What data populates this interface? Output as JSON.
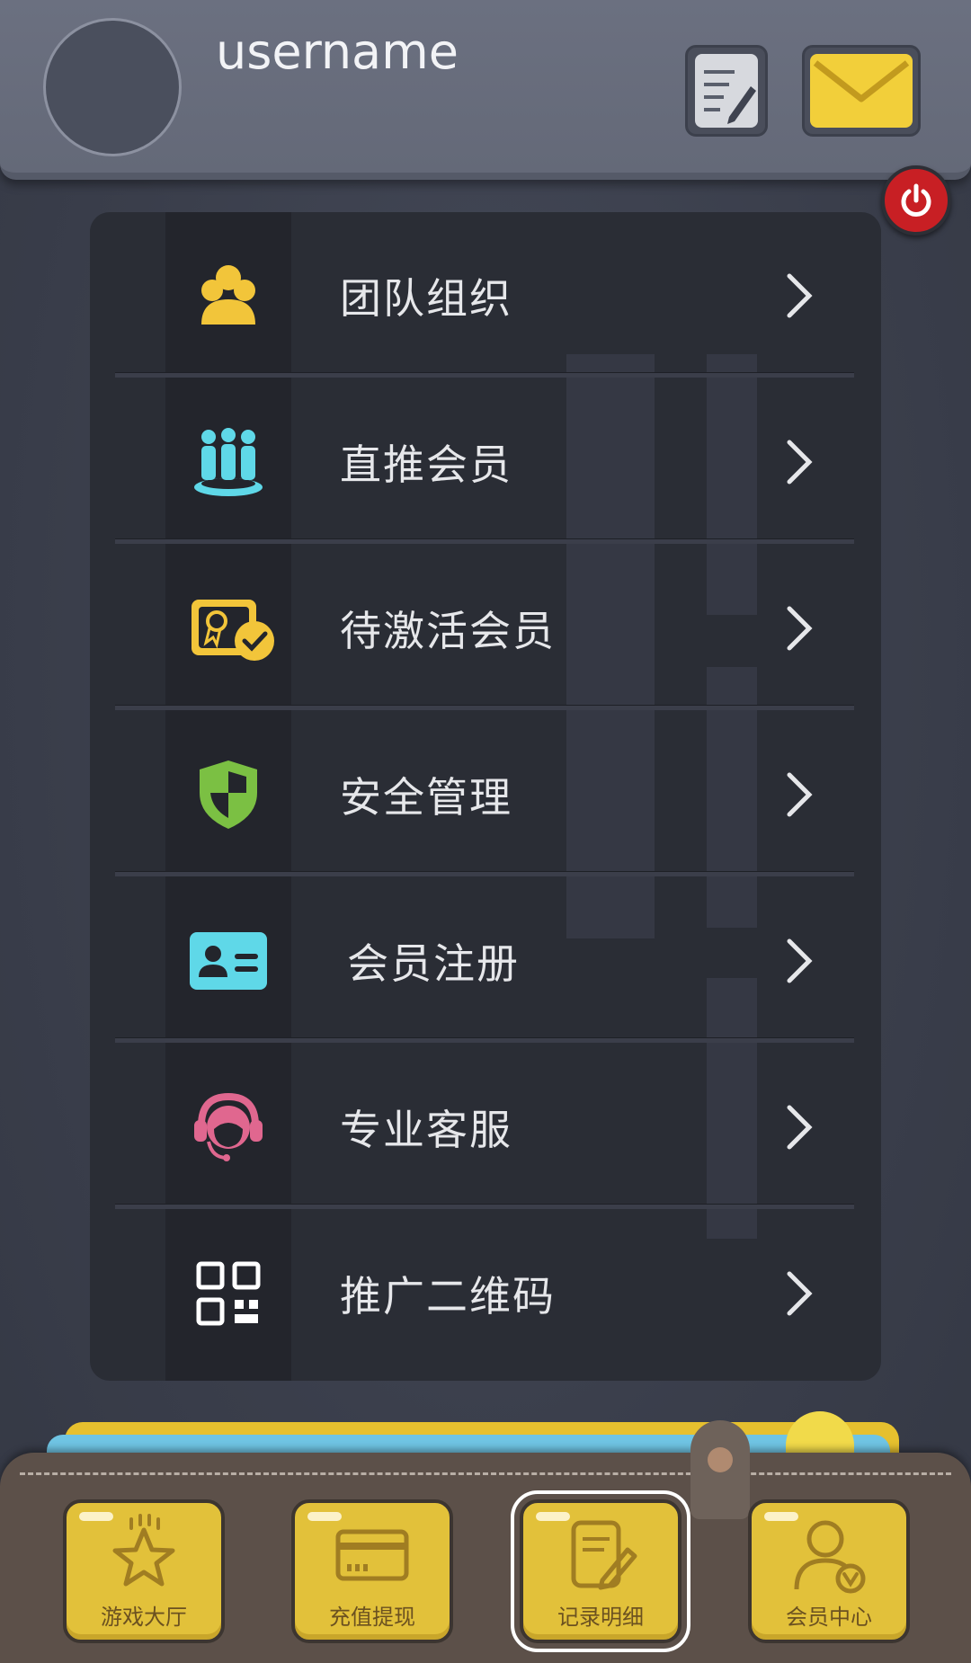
{
  "header": {
    "username": "username"
  },
  "menu": {
    "items": [
      {
        "label": "团队组织",
        "icon": "team-org-icon"
      },
      {
        "label": "直推会员",
        "icon": "direct-members-icon"
      },
      {
        "label": "待激活会员",
        "icon": "pending-activation-icon"
      },
      {
        "label": "安全管理",
        "icon": "security-shield-icon"
      },
      {
        "label": "会员注册",
        "icon": "member-card-icon"
      },
      {
        "label": "专业客服",
        "icon": "customer-service-icon"
      },
      {
        "label": "推广二维码",
        "icon": "qr-code-icon"
      }
    ]
  },
  "bottom_nav": {
    "tabs": [
      {
        "label": "游戏大厅",
        "icon": "star-icon"
      },
      {
        "label": "充值提现",
        "icon": "card-icon"
      },
      {
        "label": "记录明细",
        "icon": "record-edit-icon",
        "active": true
      },
      {
        "label": "会员中心",
        "icon": "member-user-icon"
      }
    ]
  },
  "colors": {
    "accent_yellow": "#e2c13a",
    "power_red": "#c81f24",
    "panel_bg": "#2a2d35",
    "cyan": "#5fd8e8",
    "green": "#7bc043",
    "pink": "#e0678f"
  }
}
